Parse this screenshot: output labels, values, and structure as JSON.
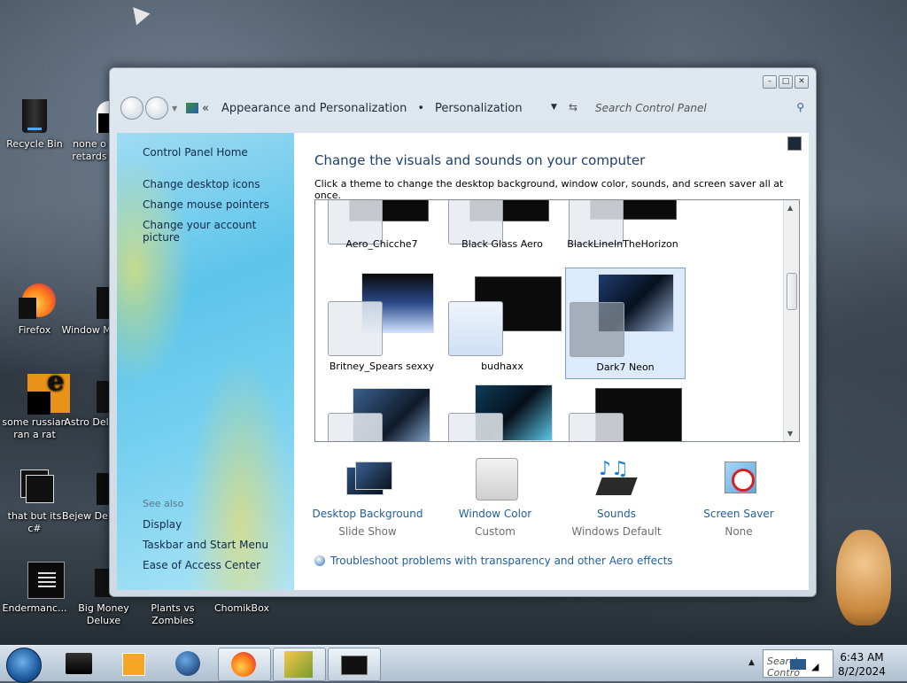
{
  "desktop": {
    "icons": [
      {
        "label": "Recycle Bin"
      },
      {
        "label": "none o retards"
      },
      {
        "label": "Firefox"
      },
      {
        "label": "Window Ma"
      },
      {
        "label": "some russian ran a rat"
      },
      {
        "label": "Astro Delu"
      },
      {
        "label": "that but its c#"
      },
      {
        "label": "Bejew Delu"
      },
      {
        "label": "Endermanc..."
      },
      {
        "label": "Big Money Deluxe"
      },
      {
        "label": "Plants vs Zombies"
      },
      {
        "label": "ChomikBox"
      }
    ]
  },
  "window": {
    "breadcrumb": [
      "Appearance and Personalization",
      "Personalization"
    ],
    "search_placeholder": "Search Control Panel",
    "sidebar": {
      "home": "Control Panel Home",
      "links": [
        "Change desktop icons",
        "Change mouse pointers",
        "Change your account picture"
      ],
      "see_also": "See also",
      "see_also_links": [
        "Display",
        "Taskbar and Start Menu",
        "Ease of Access Center"
      ]
    },
    "title": "Change the visuals and sounds on your computer",
    "subtitle": "Click a theme to change the desktop background, window color, sounds, and screen saver all at once.",
    "themes": [
      {
        "name": "Aero_Chicche7"
      },
      {
        "name": "Black Glass Aero"
      },
      {
        "name": "BlackLineInTheHorizon"
      },
      {
        "name": "Britney_Spears sexxy"
      },
      {
        "name": "budhaxx"
      },
      {
        "name": "Dark7 Neon",
        "selected": true
      }
    ],
    "bottom": [
      {
        "label": "Desktop Background",
        "sub": "Slide Show"
      },
      {
        "label": "Window Color",
        "sub": "Custom"
      },
      {
        "label": "Sounds",
        "sub": "Windows Default"
      },
      {
        "label": "Screen Saver",
        "sub": "None"
      }
    ],
    "troubleshoot": "Troubleshoot problems with transparency and other Aero effects"
  },
  "taskbar": {
    "tray_search": "Search Contro",
    "time": "6:43 AM",
    "date": "8/2/2024"
  }
}
